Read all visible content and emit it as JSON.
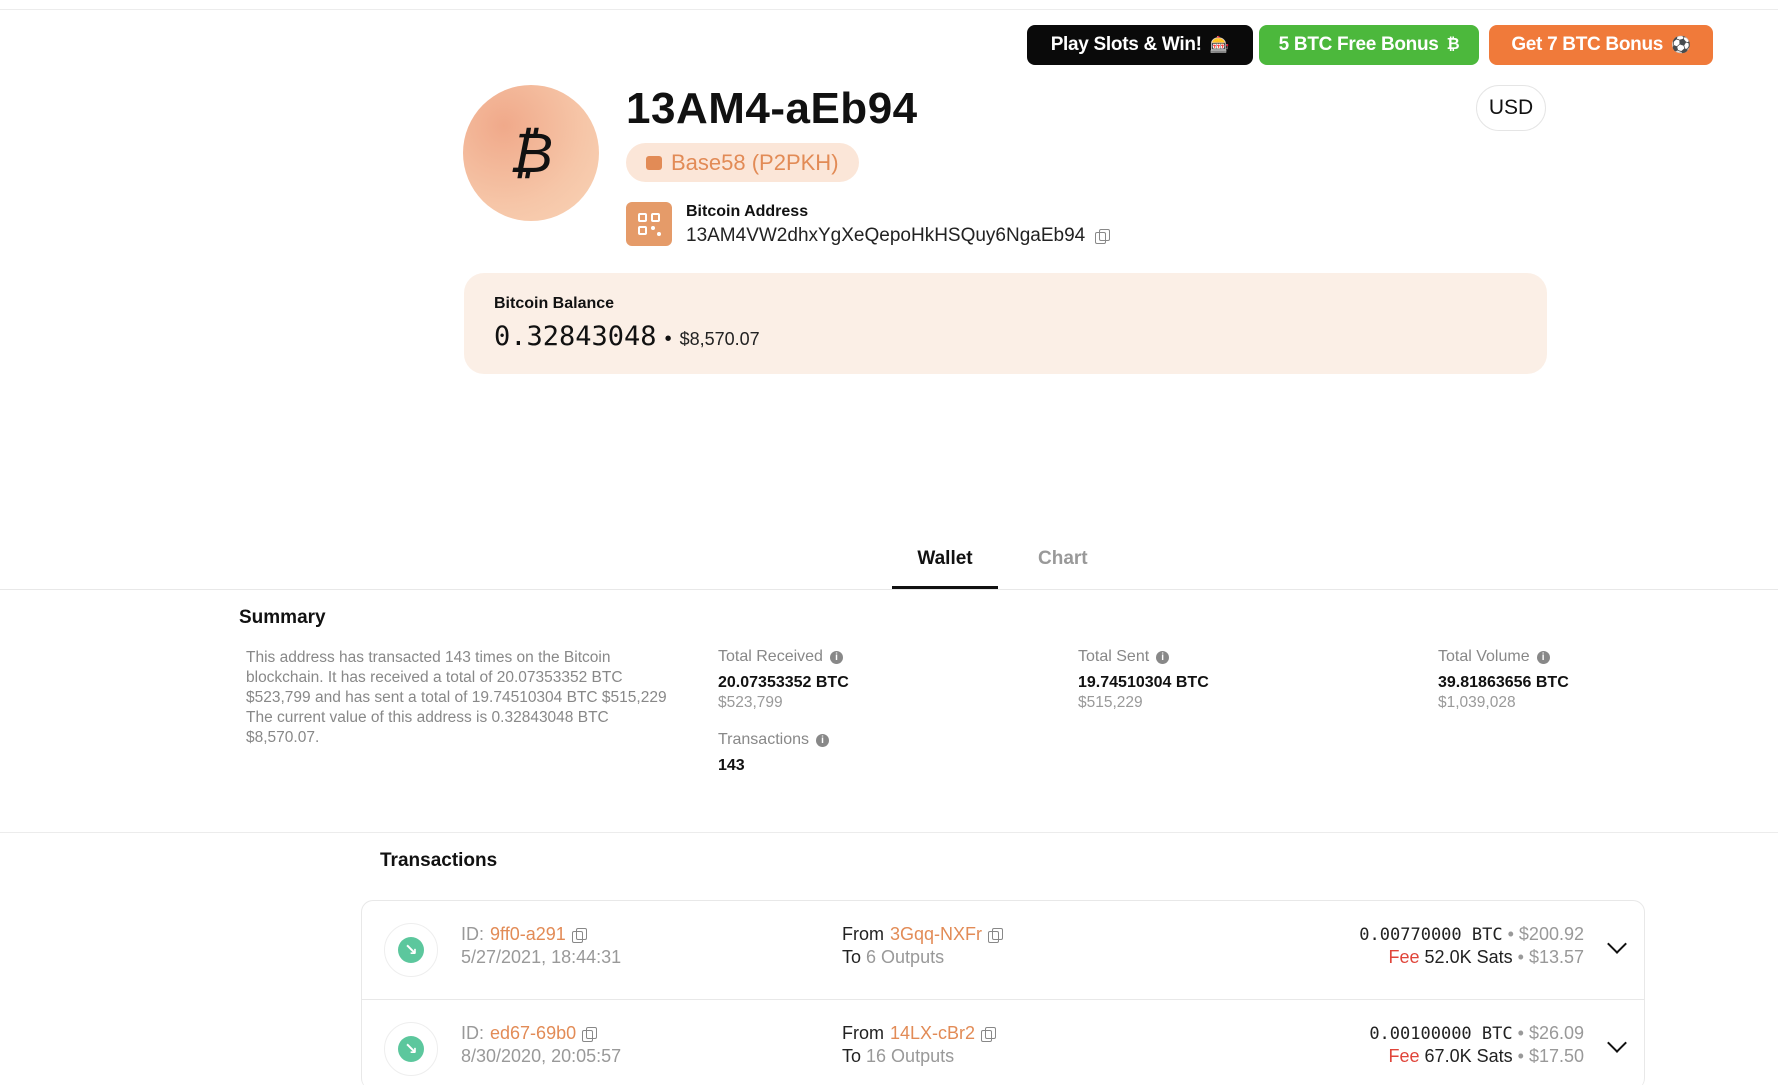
{
  "promos": [
    {
      "label": "Play Slots & Win!",
      "icon": "🎰",
      "color": "#0a0a0a"
    },
    {
      "label": "5 BTC Free Bonus",
      "icon": "₿",
      "color": "#4cb83c"
    },
    {
      "label": "Get 7 BTC Bonus",
      "icon": "⚽",
      "color": "#f07a3a"
    }
  ],
  "header": {
    "avatar_symbol": "₿",
    "title": "13AM4-aEb94",
    "address_type": "Base58 (P2PKH)",
    "currency": "USD",
    "address_label": "Bitcoin Address",
    "address_full": "13AM4VW2dhxYgXeQepoHkHSQuy6NgaEb94"
  },
  "balance": {
    "label": "Bitcoin Balance",
    "btc": "0.32843048",
    "separator": "•",
    "usd": "$8,570.07"
  },
  "tabs": {
    "wallet": "Wallet",
    "chart": "Chart",
    "active": "Wallet"
  },
  "summary": {
    "title": "Summary",
    "text": "This address has transacted 143 times on the Bitcoin blockchain. It has received a total of 20.07353352 BTC $523,799 and has sent a total of 19.74510304 BTC $515,229 The current value of this address is 0.32843048 BTC $8,570.07.",
    "stats": {
      "received": {
        "label": "Total Received",
        "btc": "20.07353352 BTC",
        "usd": "$523,799"
      },
      "sent": {
        "label": "Total Sent",
        "btc": "19.74510304 BTC",
        "usd": "$515,229"
      },
      "volume": {
        "label": "Total Volume",
        "btc": "39.81863656 BTC",
        "usd": "$1,039,028"
      },
      "transactions": {
        "label": "Transactions",
        "value": "143"
      }
    }
  },
  "transactions": {
    "title": "Transactions",
    "items": [
      {
        "id_label": "ID:",
        "id": "9ff0-a291",
        "date": "5/27/2021, 18:44:31",
        "from_label": "From",
        "from": "3Gqq-NXFr",
        "to_label": "To",
        "to": "6 Outputs",
        "amount_btc": "0.00770000 BTC",
        "amount_usd": "$200.92",
        "fee_label": "Fee",
        "fee_sats": "52.0K Sats",
        "fee_usd": "$13.57"
      },
      {
        "id_label": "ID:",
        "id": "ed67-69b0",
        "date": "8/30/2020, 20:05:57",
        "from_label": "From",
        "from": "14LX-cBr2",
        "to_label": "To",
        "to": "16 Outputs",
        "amount_btc": "0.00100000 BTC",
        "amount_usd": "$26.09",
        "fee_label": "Fee",
        "fee_sats": "67.0K Sats",
        "fee_usd": "$17.50"
      }
    ]
  },
  "colors": {
    "accent": "#e28b56",
    "received": "#5cc79d",
    "fee": "#e0453a",
    "card": "#fbefe6"
  }
}
